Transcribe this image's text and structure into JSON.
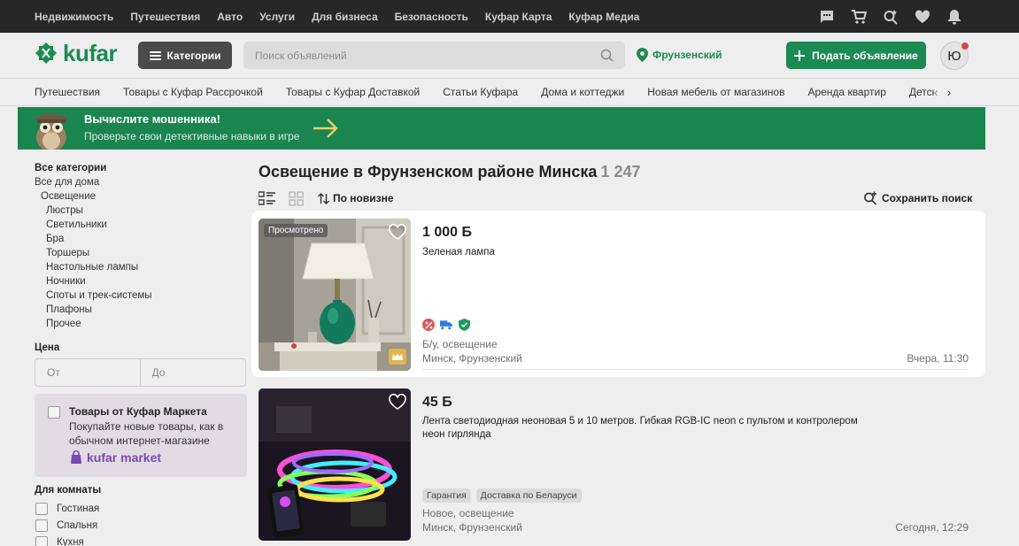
{
  "topnav": {
    "items": [
      "Недвижимость",
      "Путешествия",
      "Авто",
      "Услуги",
      "Для бизнеса",
      "Безопасность",
      "Куфар Карта",
      "Куфар Медиа"
    ]
  },
  "header": {
    "logo_text": "kufar",
    "categories_label": "Категории",
    "search_placeholder": "Поиск объявлений",
    "location": "Фрунзенский",
    "post_label": "Подать объявление",
    "avatar_letter": "Ю"
  },
  "catnav": {
    "items": [
      "Путешествия",
      "Товары с Куфар Рассрочкой",
      "Товары с Куфар Доставкой",
      "Статьи Куфара",
      "Дома и коттеджи",
      "Новая мебель от магазинов",
      "Аренда квартир",
      "Детские товары"
    ],
    "prev": "‹",
    "next": "›"
  },
  "banner": {
    "title": "Вычислите мошенника!",
    "subtitle": "Проверьте свои детективные навыки в игре"
  },
  "sidebar": {
    "all_categories": "Все категории",
    "all_home": "Все для дома",
    "lighting": "Освещение",
    "subcategories": [
      "Люстры",
      "Светильники",
      "Бра",
      "Торшеры",
      "Настольные лампы",
      "Ночники",
      "Споты и трек-системы",
      "Плафоны",
      "Прочее"
    ],
    "price_label": "Цена",
    "price_from": "От",
    "price_to": "До",
    "market_title": "Товары от Куфар Маркета",
    "market_text": "Покупайте новые товары, как в обычном интернет-магазине",
    "market_logo": "kufar market",
    "room_label": "Для комнаты",
    "rooms": [
      "Гостиная",
      "Спальня",
      "Кухня"
    ]
  },
  "main": {
    "title": "Освещение в Фрунзенском районе Минска",
    "count": "1 247",
    "sort_label": "По новизне",
    "save_search": "Сохранить поиск"
  },
  "listings": [
    {
      "seen_label": "Просмотрено",
      "price": "1 000 Б",
      "title": "Зеленая лампа",
      "condition": "Б/у, освещение",
      "location": "Минск, Фрунзенский",
      "time": "Вчера, 11:30"
    },
    {
      "price": "45 Б",
      "title": "Лента светодиодная неоновая 5 и 10 метров. Гибкая RGB-IC neon с пультом и контролером неон гирлянда",
      "tags": [
        "Гарантия",
        "Доставка по Беларуси"
      ],
      "condition": "Новое, освещение",
      "location": "Минск, Фрунзенский",
      "time": "Сегодня, 12:29"
    }
  ],
  "colors": {
    "brand": "#1c8a53",
    "topbar": "#272727",
    "market": "#7a49b3"
  }
}
